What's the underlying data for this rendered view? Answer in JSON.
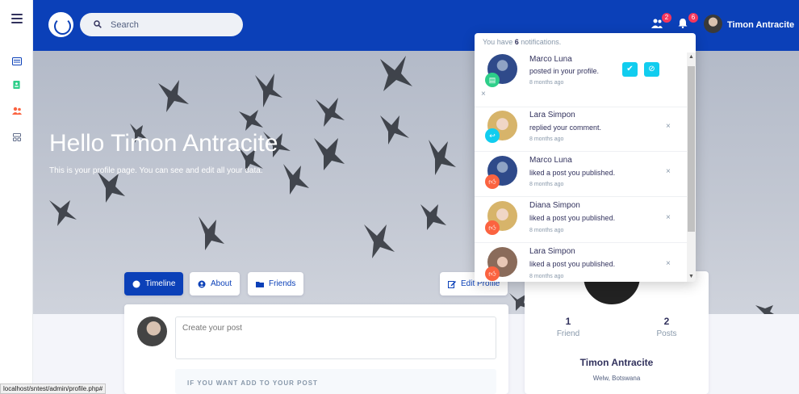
{
  "search": {
    "placeholder": "Search"
  },
  "header": {
    "user_name": "Timon Antracite",
    "friend_requests_badge": "2",
    "notifications_badge": "6"
  },
  "hero": {
    "title": "Hello Timon Antracite",
    "subtitle": "This is your profile page. You can see and edit all your data."
  },
  "tabs": [
    {
      "label": "Timeline"
    },
    {
      "label": "About"
    },
    {
      "label": "Friends"
    }
  ],
  "edit_profile_label": "Edit Profile",
  "post": {
    "placeholder": "Create your post",
    "add_label": "IF YOU WANT ADD TO YOUR POST"
  },
  "profile": {
    "friends_count": "1",
    "friends_label": "Friend",
    "posts_count": "2",
    "posts_label": "Posts",
    "name": "Timon Antracite",
    "location": "Welw, Botswana"
  },
  "notifications": {
    "header_prefix": "You have ",
    "count": "6",
    "header_suffix": " notifications.",
    "items": [
      {
        "name": "Marco Luna",
        "text": "posted in your profile.",
        "time": "8 months ago"
      },
      {
        "name": "Lara Simpon",
        "text": "replied your comment.",
        "time": "8 months ago"
      },
      {
        "name": "Marco Luna",
        "text": "liked a post you published.",
        "time": "8 months ago"
      },
      {
        "name": "Diana Simpon",
        "text": "liked a post you published.",
        "time": "8 months ago"
      },
      {
        "name": "Lara Simpon",
        "text": "liked a post you published.",
        "time": "8 months ago"
      }
    ]
  },
  "status_url": "localhost/sntest/admin/profile.php#",
  "colors": {
    "primary": "#0b40b8",
    "info": "#11cdef",
    "danger": "#f5365c",
    "success": "#2dce89",
    "warning_orange": "#fb6340"
  }
}
